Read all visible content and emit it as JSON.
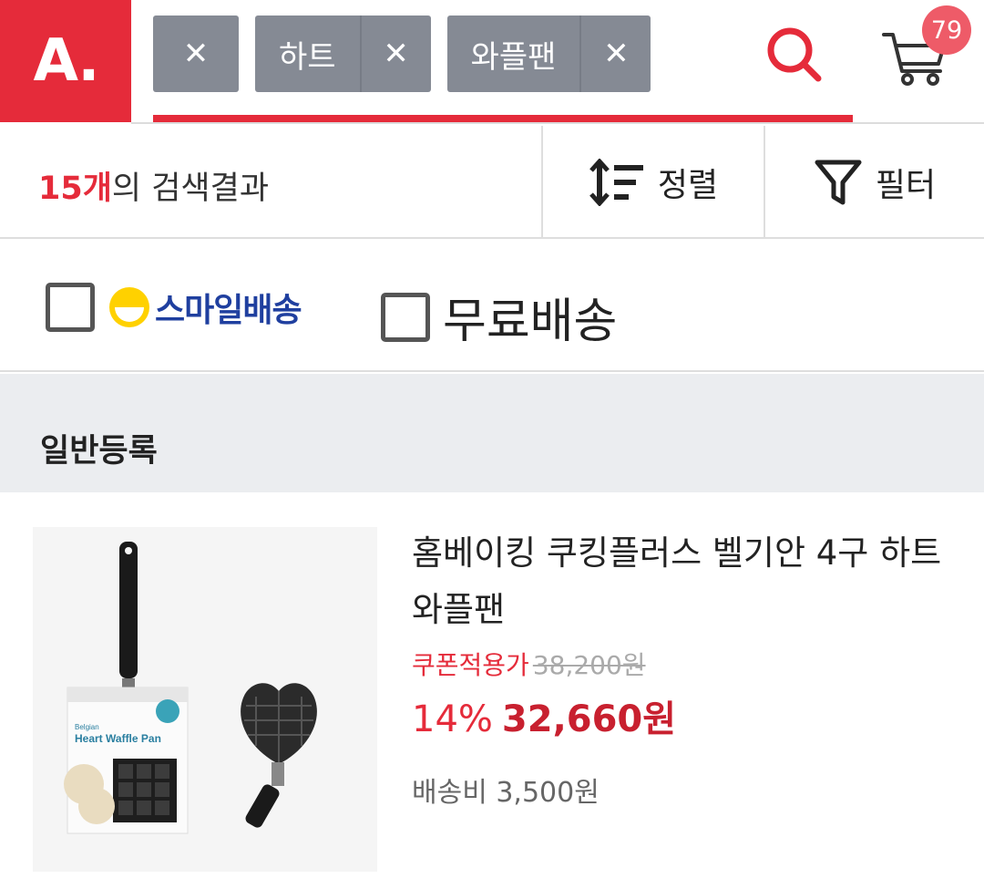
{
  "brand": {
    "logo": "A."
  },
  "header": {
    "chips": [
      {
        "label": "",
        "remove_icon": "close-icon"
      },
      {
        "label": "하트",
        "remove_icon": "close-icon"
      },
      {
        "label": "와플팬",
        "remove_icon": "close-icon"
      }
    ],
    "search_icon": "search-icon",
    "cart_icon": "cart-icon",
    "cart_count": "79",
    "accent_color": "#e52b3a"
  },
  "results": {
    "count": "15개",
    "suffix": "의 검색결과",
    "sort_label": "정렬",
    "filter_label": "필터"
  },
  "options": {
    "smile_delivery": "스마일배송",
    "free_delivery": "무료배송"
  },
  "section": {
    "title": "일반등록"
  },
  "product": {
    "name": "홈베이킹 쿠킹플러스 벨기안 4구 하트 와플팬",
    "coupon_label": "쿠폰적용가",
    "original_price": "38,200원",
    "discount": "14%",
    "sale_price": "32,660원",
    "shipping": "배송비 3,500원",
    "box_brand": "Belgian",
    "box_title": "Heart Waffle Pan"
  }
}
